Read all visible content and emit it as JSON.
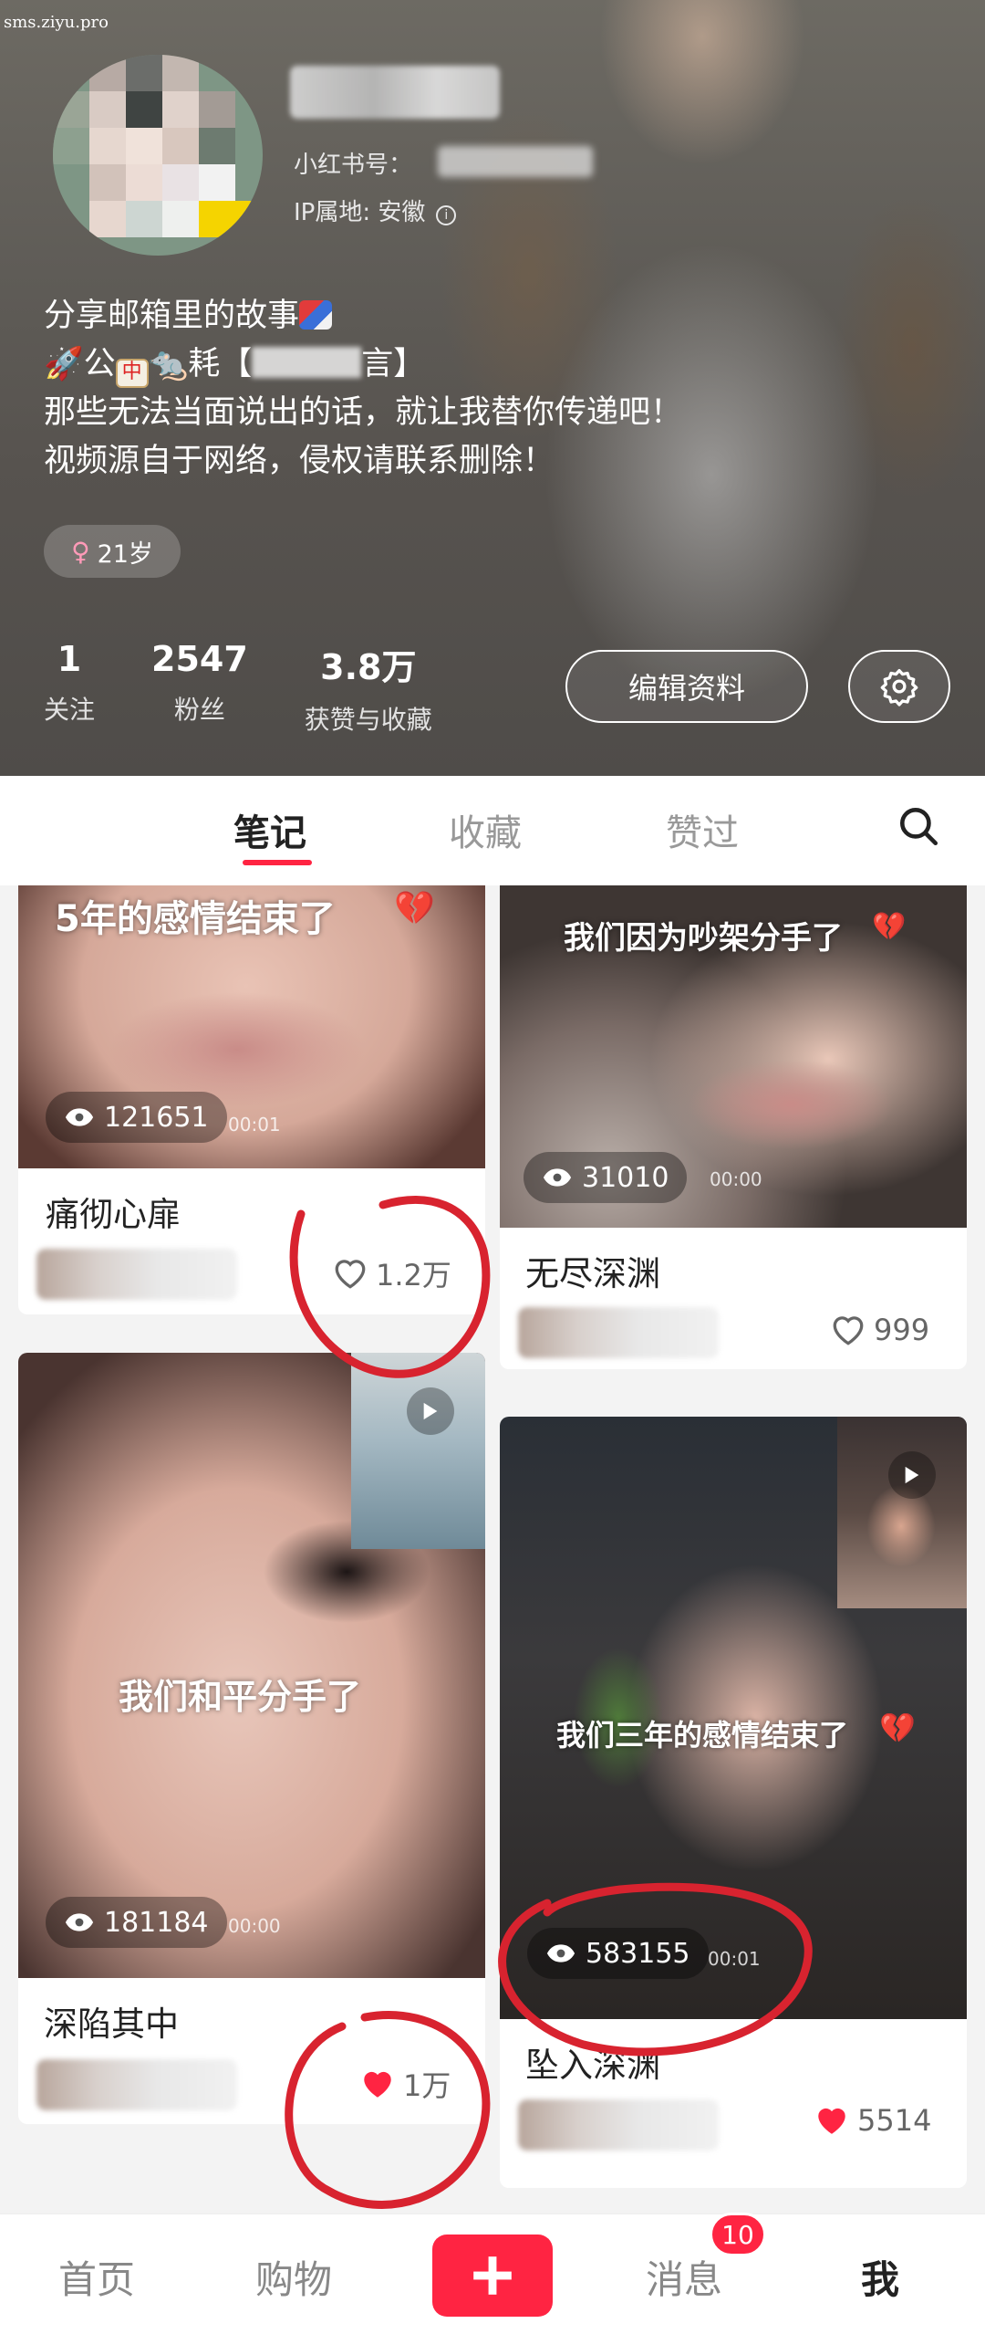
{
  "watermark": "sms.ziyu.pro",
  "profile": {
    "redbook_id_label": "小红书号：",
    "ip_location": "IP属地: 安徽",
    "bio_line1": "分享邮箱里的故事",
    "bio_line2_a": "公",
    "bio_line2_b": "耗【",
    "bio_line2_c": "言】",
    "bio_line3": "那些无法当面说出的话，就让我替你传递吧！",
    "bio_line4": "视频源自于网络，侵权请联系删除！",
    "age": "21岁",
    "stats": [
      {
        "num": "1",
        "label": "关注"
      },
      {
        "num": "2547",
        "label": "粉丝"
      },
      {
        "num": "3.8万",
        "label": "获赞与收藏"
      }
    ],
    "edit_label": "编辑资料"
  },
  "tabs": [
    "笔记",
    "收藏",
    "赞过"
  ],
  "notes": [
    {
      "overlay": "5年的感情结束了",
      "views": "121651",
      "duration": "00:01",
      "title": "痛彻心扉",
      "likes": "1.2万"
    },
    {
      "overlay": "我们因为吵架分手了",
      "views": "31010",
      "duration": "00:00",
      "title": "无尽深渊",
      "likes": "999"
    },
    {
      "overlay": "我们和平分手了",
      "views": "181184",
      "duration": "00:00",
      "title": "深陷其中",
      "likes": "1万"
    },
    {
      "overlay": "我们三年的感情结束了",
      "views": "583155",
      "duration": "00:01",
      "title": "坠入深渊",
      "likes": "5514"
    }
  ],
  "nav": {
    "home": "首页",
    "shop": "购物",
    "messages": "消息",
    "me": "我",
    "badge": "10"
  },
  "colors": {
    "accent": "#ff2442",
    "annotation": "#d8232f"
  }
}
